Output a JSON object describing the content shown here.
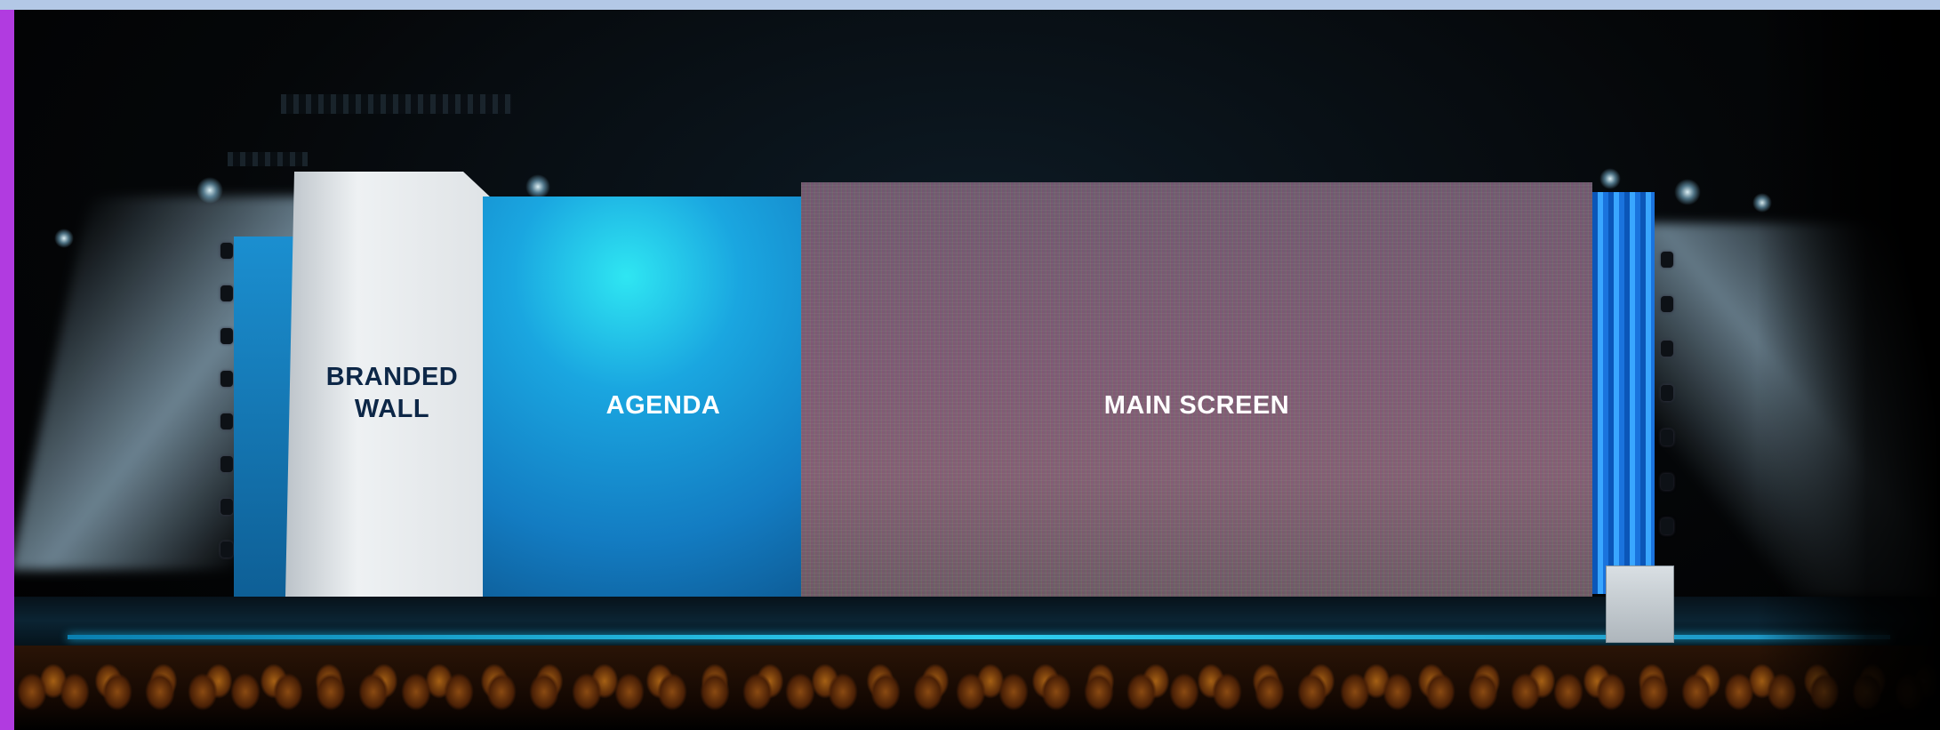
{
  "stage_layout": {
    "branded_wall_label": "BRANDED WALL",
    "agenda_label": "AGENDA",
    "main_screen_label": "MAIN SCREEN"
  },
  "colors": {
    "top_bar": "#b3c8e6",
    "left_bar": "#b13be0",
    "branded_text": "#0d2747",
    "screen_text": "#ffffff",
    "agenda_panel": "#1aa6e0",
    "side_led": "#39a6ff"
  }
}
